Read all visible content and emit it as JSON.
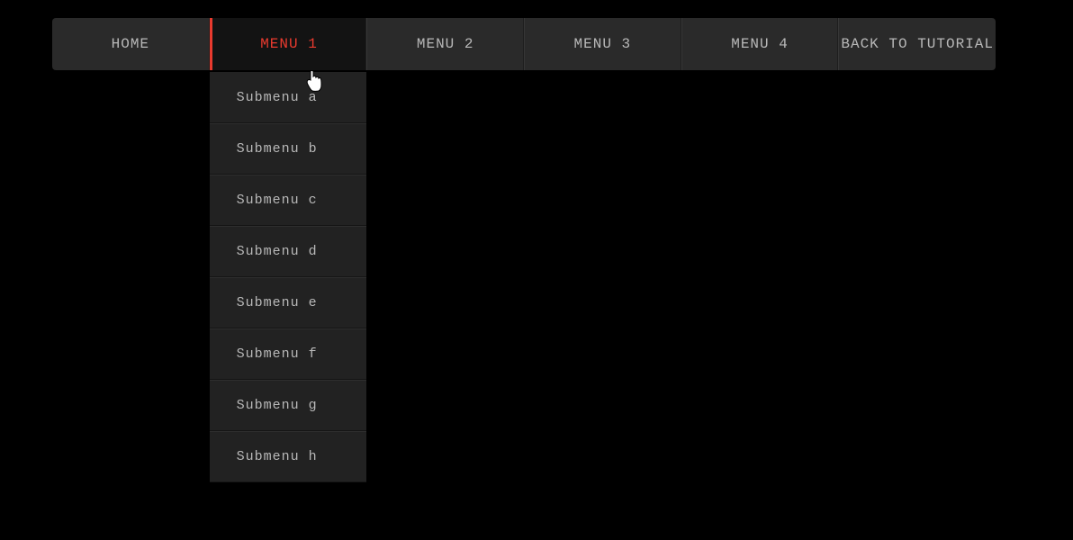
{
  "nav": {
    "items": [
      {
        "label": "Home",
        "active": false
      },
      {
        "label": "Menu 1",
        "active": true
      },
      {
        "label": "Menu 2",
        "active": false
      },
      {
        "label": "Menu 3",
        "active": false
      },
      {
        "label": "Menu 4",
        "active": false
      },
      {
        "label": "Back to Tutorial",
        "active": false
      }
    ],
    "submenu": [
      {
        "label": "Submenu a"
      },
      {
        "label": "Submenu b"
      },
      {
        "label": "Submenu c"
      },
      {
        "label": "Submenu d"
      },
      {
        "label": "Submenu e"
      },
      {
        "label": "Submenu f"
      },
      {
        "label": "Submenu g"
      },
      {
        "label": "Submenu h"
      }
    ]
  },
  "colors": {
    "accent": "#e93a2e",
    "bg_nav": "#2a2a2a",
    "bg_active": "#131313",
    "bg_sub": "#222222"
  }
}
